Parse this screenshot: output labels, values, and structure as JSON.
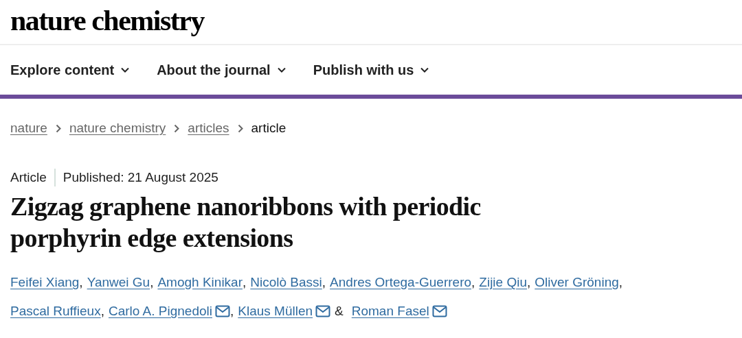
{
  "logo": {
    "text": "nature chemistry"
  },
  "nav": {
    "items": [
      {
        "label": "Explore content"
      },
      {
        "label": "About the journal"
      },
      {
        "label": "Publish with us"
      }
    ]
  },
  "breadcrumb": [
    {
      "label": "nature",
      "current": false
    },
    {
      "label": "nature chemistry",
      "current": false
    },
    {
      "label": "articles",
      "current": false
    },
    {
      "label": "article",
      "current": true
    }
  ],
  "article": {
    "type": "Article",
    "published": "Published: 21 August 2025",
    "title": "Zigzag graphene nanoribbons with periodic porphyrin edge extensions",
    "authors": [
      {
        "name": "Feifei Xiang",
        "corresponding": false,
        "separator": ","
      },
      {
        "name": "Yanwei Gu",
        "corresponding": false,
        "separator": ","
      },
      {
        "name": "Amogh Kinikar",
        "corresponding": false,
        "separator": ","
      },
      {
        "name": "Nicolò Bassi",
        "corresponding": false,
        "separator": ","
      },
      {
        "name": "Andres Ortega-Guerrero",
        "corresponding": false,
        "separator": ","
      },
      {
        "name": "Zijie Qiu",
        "corresponding": false,
        "separator": ","
      },
      {
        "name": "Oliver Gröning",
        "corresponding": false,
        "separator": ","
      },
      {
        "name": "Pascal Ruffieux",
        "corresponding": false,
        "separator": ","
      },
      {
        "name": "Carlo A. Pignedoli",
        "corresponding": true,
        "separator": ","
      },
      {
        "name": "Klaus Müllen",
        "corresponding": true,
        "separator": "&"
      },
      {
        "name": "Roman Fasel",
        "corresponding": true
      }
    ]
  }
}
